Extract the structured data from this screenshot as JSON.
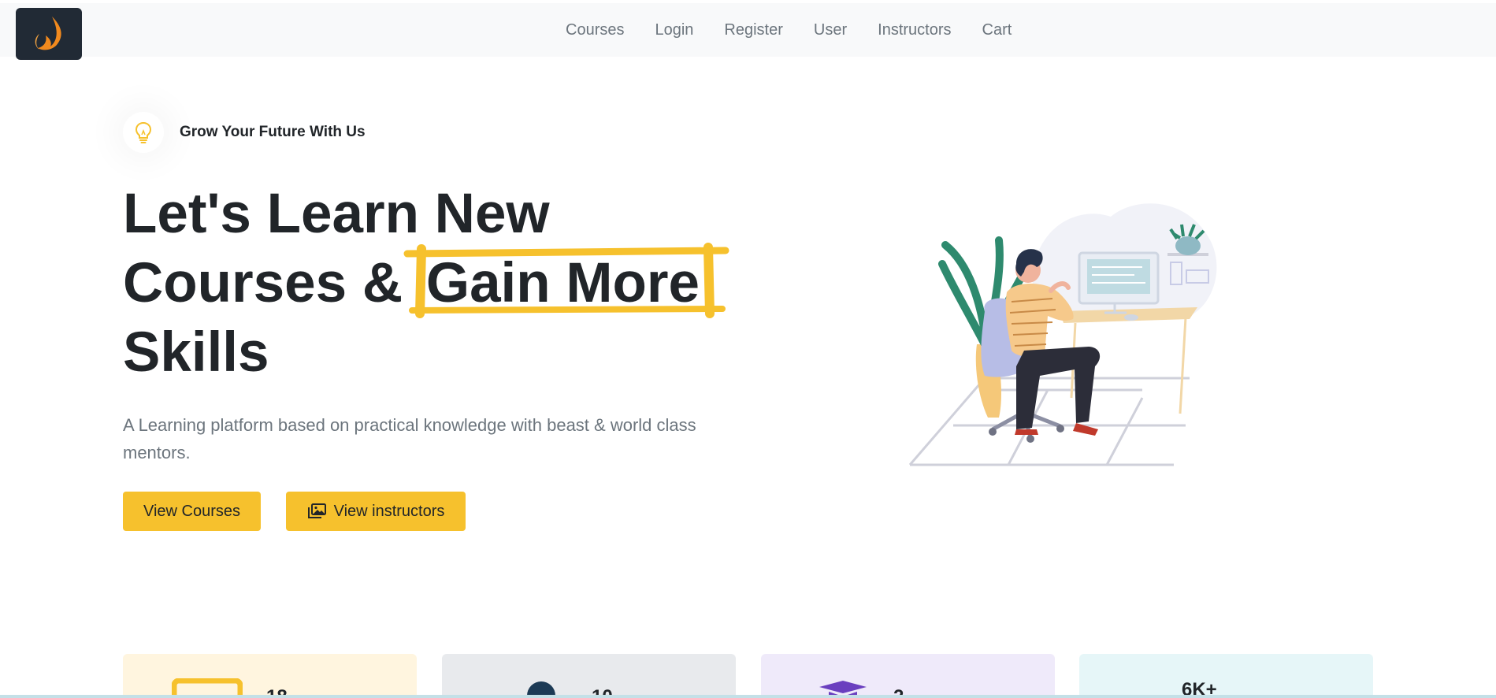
{
  "nav": {
    "logo_icon": "flame-logo-icon",
    "links": [
      "Courses",
      "Login",
      "Register",
      "User",
      "Instructors",
      "Cart"
    ]
  },
  "hero": {
    "badge_icon": "lightbulb-icon",
    "badge_text": "Grow Your Future With Us",
    "title_line1": "Let's Learn New",
    "title_line2_pre": "Courses & ",
    "title_highlight": "Gain More",
    "title_line3": "Skills",
    "subtitle": "A Learning platform based on practical knowledge with beast & world class mentors.",
    "btn_courses": "View Courses",
    "btn_instructors": "View instructors",
    "btn_instructors_icon": "photo-gallery-icon",
    "illustration": "person-at-desk-illustration"
  },
  "stats": [
    {
      "value": "18",
      "icon": "laptop-icon",
      "bg": "#fff5df"
    },
    {
      "value": "10",
      "icon": "person-icon",
      "bg": "#e8eaed"
    },
    {
      "value": "2",
      "icon": "graduation-cap-icon",
      "bg": "#efeafa"
    },
    {
      "value": "6K+",
      "icon": "",
      "bg": "#e6f6f8"
    }
  ],
  "colors": {
    "accent": "#f6c12d",
    "nav_bg": "#f8f9fa",
    "text_dark": "#212529",
    "text_muted": "#6c757d"
  }
}
